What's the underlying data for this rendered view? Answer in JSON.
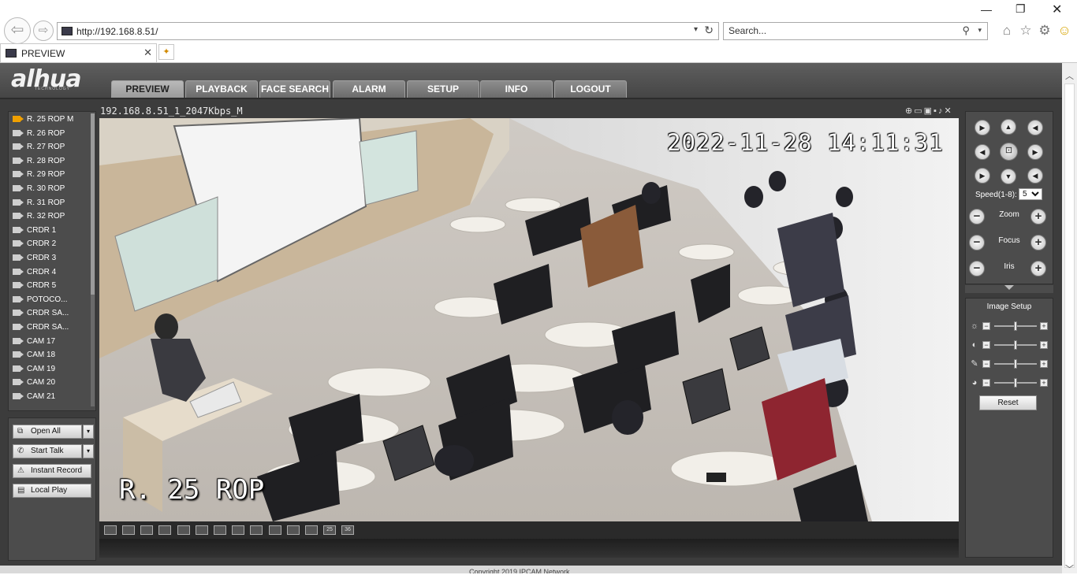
{
  "browser": {
    "url": "http://192.168.8.51/",
    "search_placeholder": "Search...",
    "tab_title": "PREVIEW"
  },
  "app": {
    "logo": "alhua",
    "logo_sub": "TECHNOLOGY",
    "nav": [
      {
        "label": "PREVIEW",
        "active": true
      },
      {
        "label": "PLAYBACK"
      },
      {
        "label": "FACE SEARCH"
      },
      {
        "label": "ALARM"
      },
      {
        "label": "SETUP"
      },
      {
        "label": "INFO"
      },
      {
        "label": "LOGOUT"
      }
    ],
    "cameras": [
      "R. 25 ROP   M",
      "R. 26 ROP",
      "R. 27 ROP",
      "R. 28 ROP",
      "R. 29 ROP",
      "R. 30 ROP",
      "R. 31 ROP",
      "R. 32 ROP",
      "CRDR 1",
      "CRDR 2",
      "CRDR 3",
      "CRDR 4",
      "CRDR 5",
      "POTOCO...",
      "CRDR SA...",
      "CRDR SA...",
      "CAM 17",
      "CAM 18",
      "CAM 19",
      "CAM 20",
      "CAM 21"
    ],
    "controls": {
      "open_all": "Open All",
      "start_talk": "Start Talk",
      "instant_record": "Instant Record",
      "local_play": "Local Play"
    },
    "video": {
      "stream_title": "192.168.8.51_1_2047Kbps_M",
      "osd_time": "2022-11-28 14:11:31",
      "osd_name": "R. 25 ROP"
    },
    "layout_buttons": [
      "",
      "",
      "",
      "",
      "",
      "",
      "",
      "",
      "",
      "",
      "",
      "",
      "",
      "25",
      "36"
    ],
    "ptz": {
      "speed_label": "Speed(1-8):",
      "speed_value": "5",
      "zoom": "Zoom",
      "focus": "Focus",
      "iris": "Iris"
    },
    "image_setup": {
      "title": "Image Setup",
      "reset": "Reset"
    },
    "footer": "Copyright 2019 IPCAM Network"
  }
}
